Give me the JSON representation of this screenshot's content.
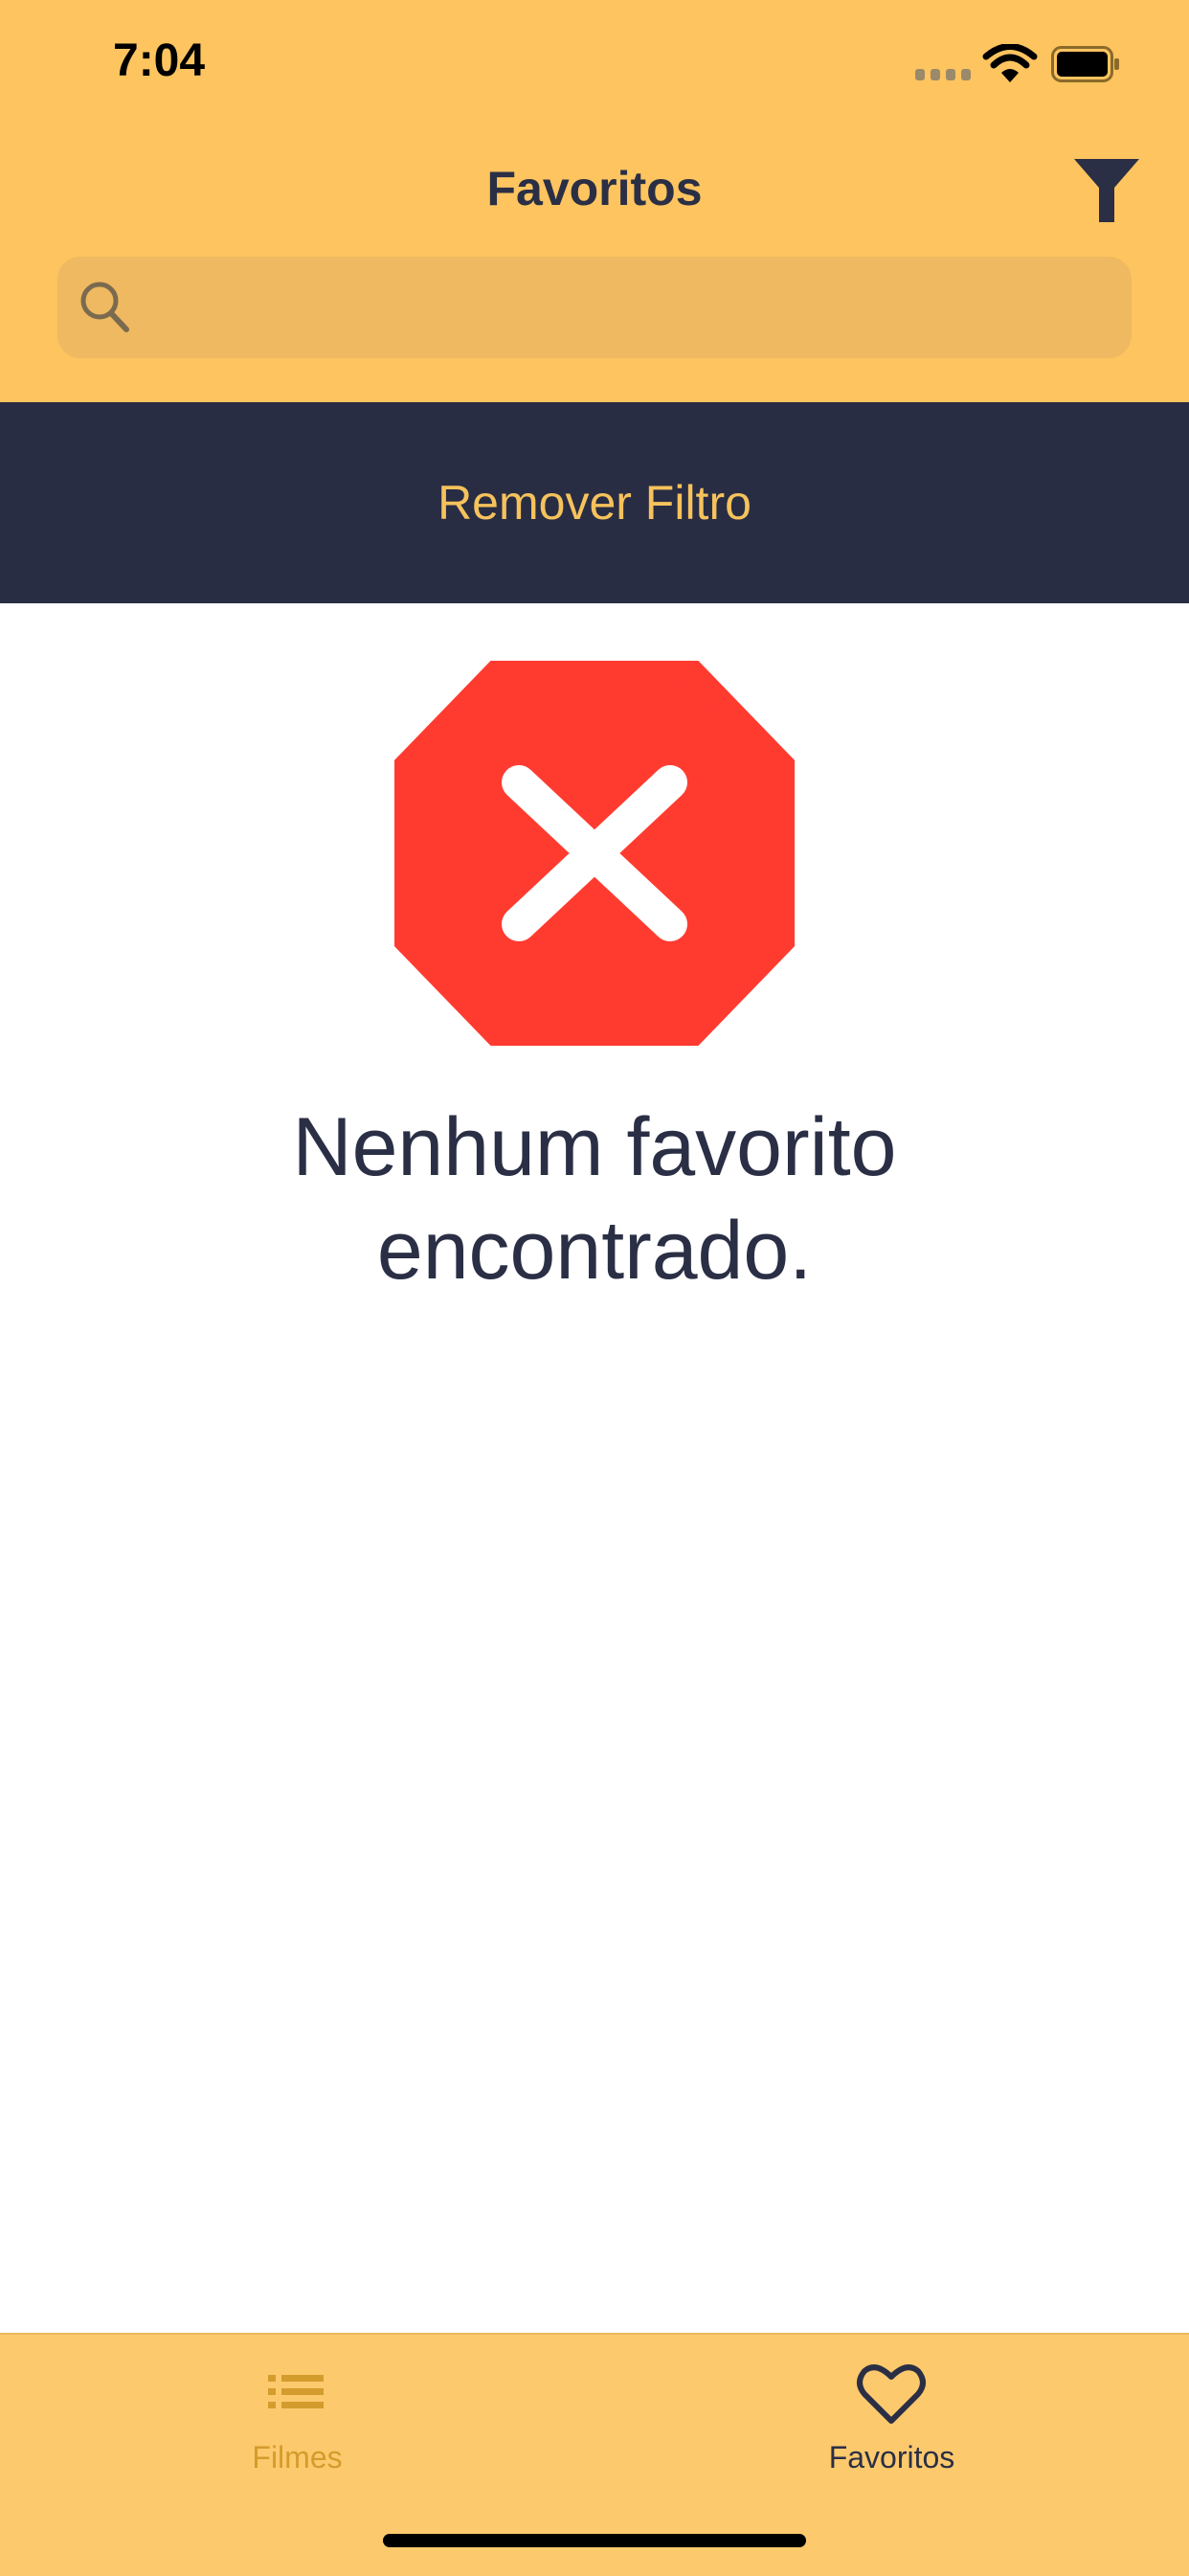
{
  "status_bar": {
    "time": "7:04"
  },
  "nav": {
    "title": "Favoritos"
  },
  "search": {
    "placeholder": "",
    "value": ""
  },
  "filter_banner": {
    "label": "Remover Filtro"
  },
  "empty_state": {
    "message": "Nenhum favorito encontrado."
  },
  "tabs": [
    {
      "label": "Filmes",
      "icon": "list-icon",
      "selected": false
    },
    {
      "label": "Favoritos",
      "icon": "heart-icon",
      "selected": true
    }
  ],
  "colors": {
    "header": "#fdc45f",
    "banner": "#292d43",
    "accent": "#f6c25c",
    "error": "#ff3b30",
    "text_dark": "#2a2f45"
  }
}
